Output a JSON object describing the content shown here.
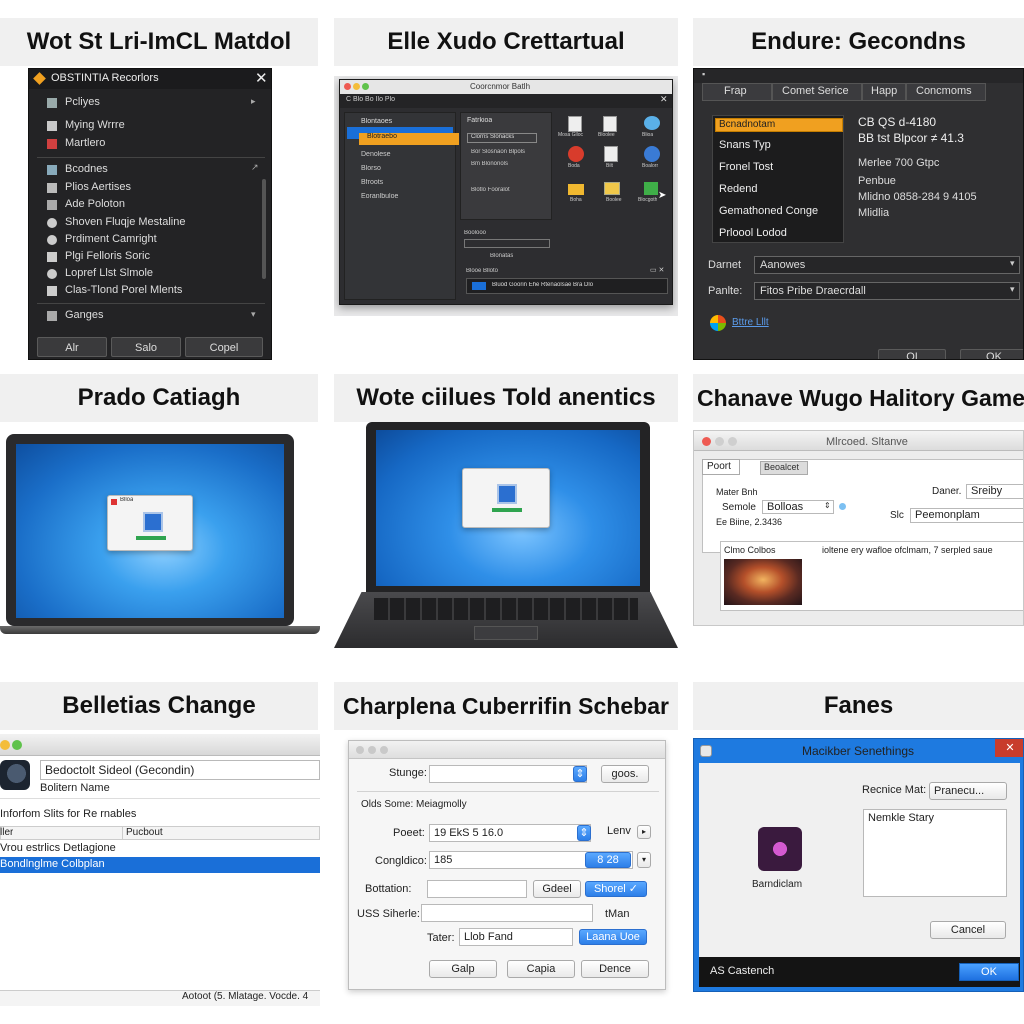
{
  "cells": {
    "c1": {
      "title": "Wot St Lri-ImCL Matdol",
      "window_title": "OBSTINTIA Recorlors",
      "items": [
        "Pcliyes",
        "Mying Wrrre",
        "Martlero",
        "Bcodnes",
        "Plios Aertises",
        "Ade Poloton",
        "Shoven Fluqje Mestaline",
        "Prdiment Camright",
        "Plgi Felloris Soric",
        "Lopref Llst Slmole",
        "Clas-Tlond Porel Mlents",
        "Ganges"
      ],
      "buttons": [
        "Alr",
        "Salo",
        "Copel"
      ]
    },
    "c2": {
      "title": "Elle Xudo Crettartual",
      "window_title": "Coorcnmor Batlh",
      "menu": "C Blo  Bo  Ilo  Plo",
      "sidebar": [
        "Blontaoes",
        "Blotraebo",
        "Denolese",
        "Blorso",
        "Bfroots",
        "Eoranlbuloe"
      ],
      "panel_title": "Fatrkioa",
      "panel_items": [
        "Clorns Slonacks",
        "Bor Slosnaon Blpols",
        "Bm Blononols",
        "Blotlo Fooralot"
      ],
      "panel_footer": [
        "Boolooo",
        "Blonatas"
      ],
      "icon_labels": [
        "Mosa Glloc",
        "Bloolee",
        "Blioa",
        "Boda",
        "Bilt",
        "Boalorr",
        "Boha",
        "Boolee",
        "Blocgoth"
      ],
      "footer_label": "Blooe Blloto",
      "footer_row": "Bluod Goorin Ehe Rtenaolsae Bra Dlo"
    },
    "c3": {
      "title": "Endure: Gecondns",
      "tabs": [
        "Frap",
        "Comet Serice",
        "Happ",
        "Concmoms"
      ],
      "list": [
        "Bcnadnotam",
        "Snans Typ",
        "Fronel Tost",
        "Redend",
        "Gemathoned Conge",
        "Prloool Lodod"
      ],
      "details": [
        "CB QS d-4180",
        "BB tst Blpcor ≠ 41.3",
        "Merlee 700 Gtpc",
        "Penbue",
        "Mlidno 0858-284 9 4105",
        "Mlidlia"
      ],
      "row1_label": "Darnet",
      "row1_value": "Aanowes",
      "row2_label": "Panlte:",
      "row2_value": "Fitos Pribe Draecrdall",
      "link": "Bttre Lllt",
      "buttons": [
        "OI",
        "OK"
      ]
    },
    "c4": {
      "title": "Prado Catiagh",
      "dialog_title": "Blloa"
    },
    "c5": {
      "title": "Wote ciilues Told anentics"
    },
    "c6": {
      "title": "Chanave Wugo Halitory Game",
      "window_title": "Mlrcoed. Sltanve",
      "tabs": [
        "Poort",
        "Beoalcet"
      ],
      "fields": [
        "Mater Bnh",
        "Semole",
        "Ee Biine, 2.3436"
      ],
      "select1": "Bolloas",
      "label_r1": "Daner.",
      "value_r1": "Sreiby",
      "label_r2": "Slc",
      "value_r2": "Peemonplam",
      "caption": "Clmo Colbos",
      "caption_r": "ioltene ery wafloe ofclmam, 7 serpled saue"
    },
    "c7": {
      "title": "Belletias Change",
      "input": "Bedoctolt Sideol (Gecondin)",
      "label": "Bolitern Name",
      "section": "Inforfom Slits for Re rnables",
      "col_headers": [
        "ller",
        "Pucbout"
      ],
      "rows": [
        "Vrou estrlics Detlagione",
        "Bondlnglme Colbplan"
      ],
      "footer": "Aotoot (5. Mlatage. Vocde. 4"
    },
    "c8": {
      "title": "Charplena Cuberrifin Schebar",
      "row_stunge": "Stunge:",
      "btn_goos": "goos.",
      "section": "Olds Some: Meiagmolly",
      "poeet_label": "Poeet:",
      "poeet_value": "19 EkS 5 16.0",
      "lenv": "Lenv",
      "congldico_label": "Congldico:",
      "congldico_value": "185",
      "congldico_btn": "8 28",
      "bottation_label": "Bottation:",
      "btn_godeel": "Gdeel",
      "btn_shorel": "Shorel ✓",
      "uss_label": "USS Siherle:",
      "iman": "tMan",
      "tater_label": "Tater:",
      "tater_value": "Llob Fand",
      "btn_laana": "Laana Uoe",
      "buttons": [
        "Galp",
        "Capia",
        "Dence"
      ]
    },
    "c9": {
      "title": "Fanes",
      "window_title": "Macikber Senethings",
      "label_mat": "Recnice Mat:",
      "value_mat": "Pranecu...",
      "icon_label": "Barndiclam",
      "text_area": "Nemkle Stary",
      "cancel": "Cancel",
      "footer_text": "AS Castench",
      "ok": "OK"
    }
  },
  "colors": {
    "dark_bg": "#2a2a2c",
    "orange_highlight": "#f0a020",
    "selection_blue": "#1a6fd8",
    "win_blue": "#1e7ae0",
    "laptop_screen": "#1f7ad6"
  }
}
